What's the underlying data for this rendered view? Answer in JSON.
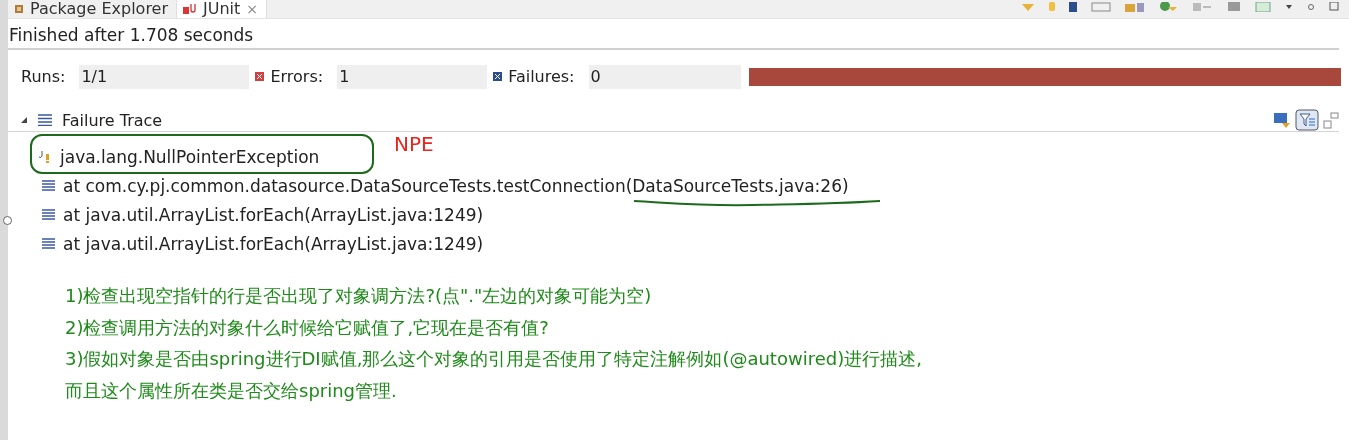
{
  "tabs": [
    {
      "label": "Package Explorer",
      "selected": false
    },
    {
      "label": "JUnit",
      "selected": true,
      "close": "×"
    }
  ],
  "status": "Finished after 1.708 seconds",
  "counters": [
    {
      "kind": "runs",
      "label": "Runs:",
      "value": "1/1"
    },
    {
      "kind": "errors",
      "label": "Errors:",
      "value": "1"
    },
    {
      "kind": "failures",
      "label": "Failures:",
      "value": "0"
    }
  ],
  "progress": {
    "level": 1,
    "failed": true
  },
  "failure_trace": {
    "title": "Failure Trace",
    "expanded": true,
    "items": [
      {
        "kind": "exception",
        "text": "java.lang.NullPointerException"
      },
      {
        "kind": "frame",
        "text": "at com.cy.pj.common.datasource.DataSourceTests.testConnection(DataSourceTests.java:26)"
      },
      {
        "kind": "frame",
        "text": "at java.util.ArrayList.forEach(ArrayList.java:1249)"
      },
      {
        "kind": "frame",
        "text": "at java.util.ArrayList.forEach(ArrayList.java:1249)"
      }
    ]
  },
  "annotation": {
    "label": "NPE",
    "notes": [
      "1)检查出现空指针的行是否出现了对象调方法?(点\".\"左边的对象可能为空)",
      "2)检查调用方法的对象什么时候给它赋值了,它现在是否有值?",
      "3)假如对象是否由spring进行DI赋值,那么这个对象的引用是否使用了特定注解例如(@autowired)进行描述,",
      "而且这个属性所在类是否交给spring管理."
    ]
  }
}
